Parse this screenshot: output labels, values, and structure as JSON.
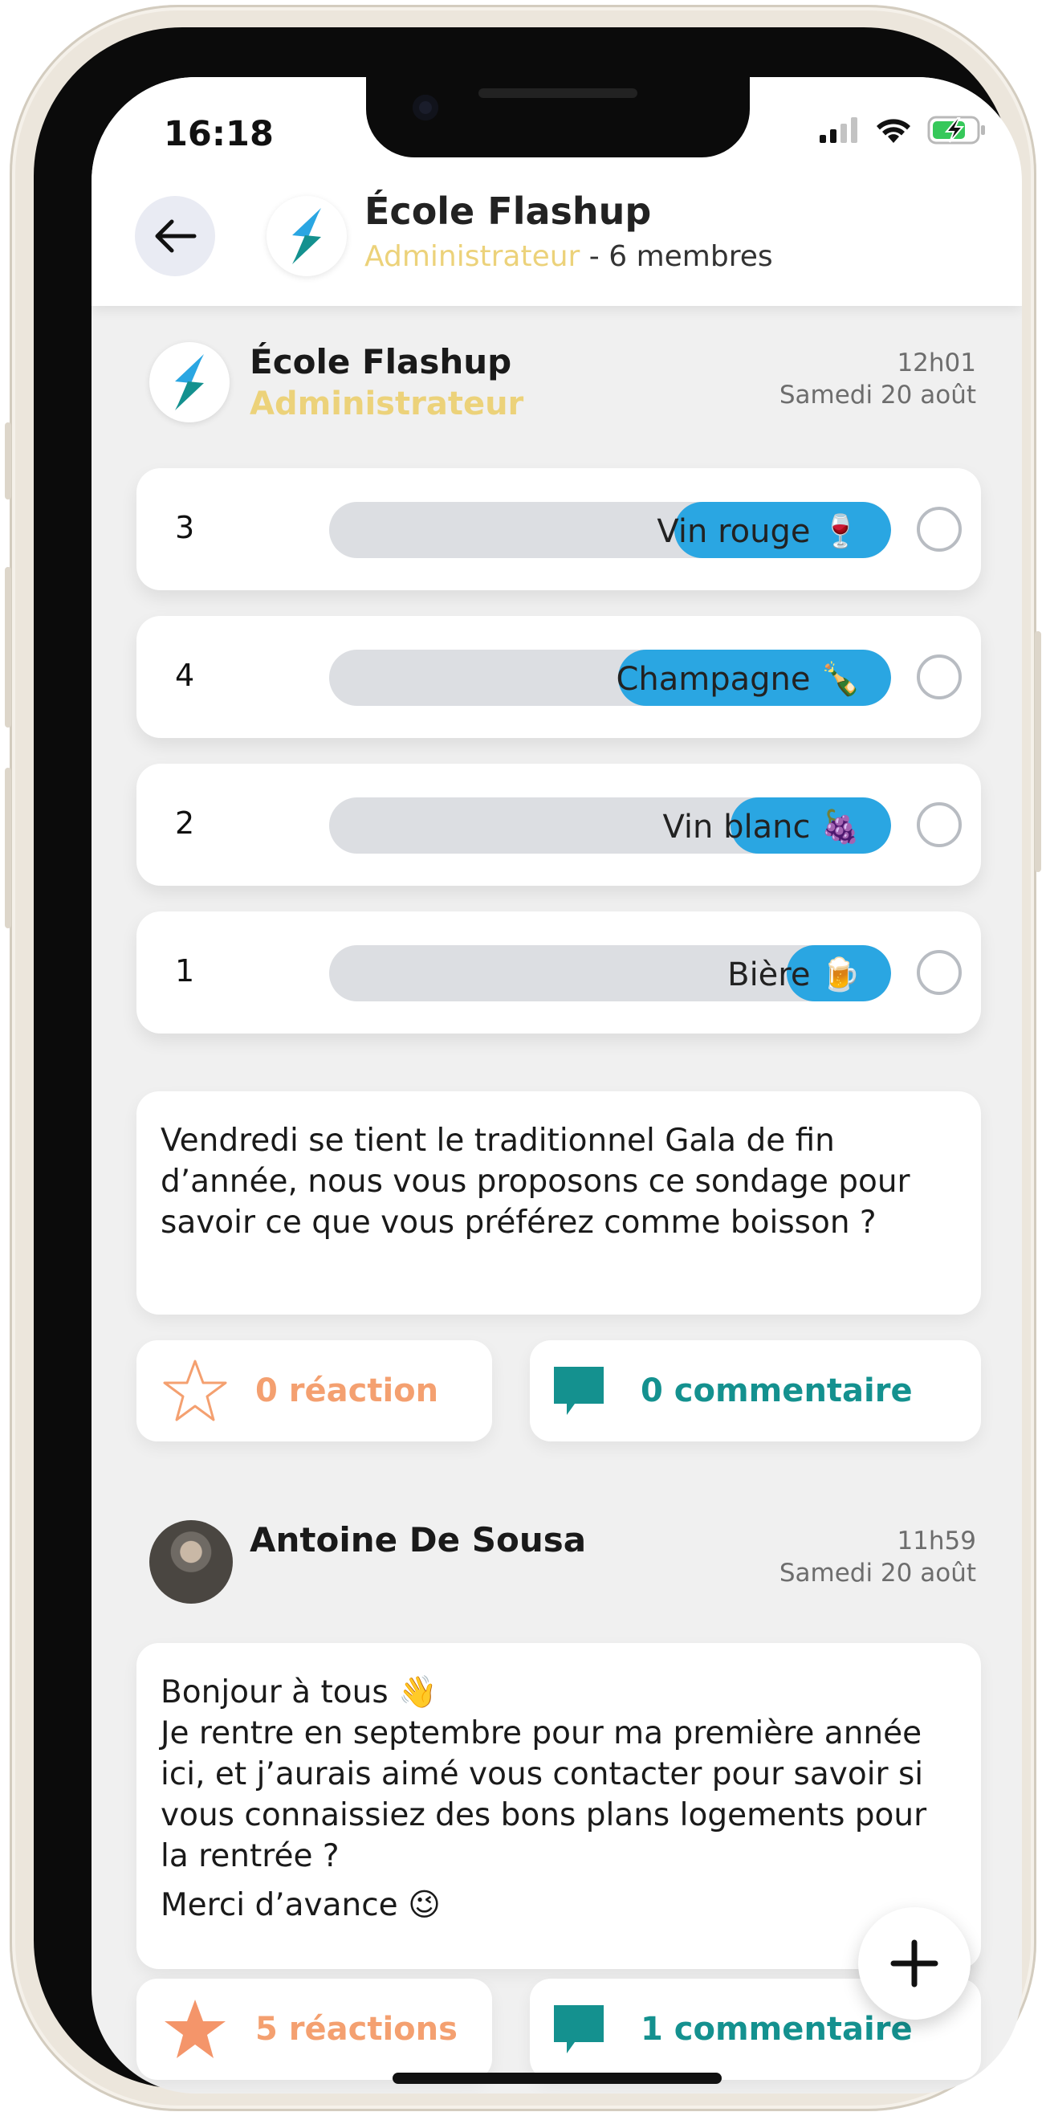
{
  "status_bar": {
    "time": "16:18"
  },
  "header": {
    "title": "École Flashup",
    "role": "Administrateur",
    "members": " - 6 membres"
  },
  "poll_post": {
    "author": "École Flashup",
    "role": "Administrateur",
    "time": "12h01",
    "date": "Samedi 20 août",
    "options": [
      {
        "count": "3",
        "label": "Vin rouge",
        "emoji": "🍷",
        "fraction": 0.3
      },
      {
        "count": "4",
        "label": "Champagne",
        "emoji": "🍾",
        "fraction": 0.4
      },
      {
        "count": "2",
        "label": "Vin blanc",
        "emoji": "🍇",
        "fraction": 0.2
      },
      {
        "count": "1",
        "label": "Bière",
        "emoji": "🍺",
        "fraction": 0.1
      }
    ],
    "text": "Vendredi se tient le traditionnel Gala de fin d’année, nous vous proposons ce sondage pour savoir ce que vous préférez comme boisson ?",
    "reactions": "0 réaction",
    "comments": "0 commentaire"
  },
  "second_post": {
    "author": "Antoine De Sousa",
    "time": "11h59",
    "date": "Samedi 20 août",
    "line1": "Bonjour à tous 👋",
    "line2": "Je rentre en septembre pour ma première année ici, et j’aurais aimé vous contacter pour savoir si vous connaissiez des bons plans logements pour la rentrée ?",
    "line3": "Merci d’avance 😉",
    "reactions": "5 réactions",
    "comments": "1 commentaire"
  },
  "colors": {
    "accent_blue": "#2aa6e2",
    "gold": "#ecd27a",
    "reaction_orange": "#f4a070",
    "comment_teal": "#14918f"
  }
}
